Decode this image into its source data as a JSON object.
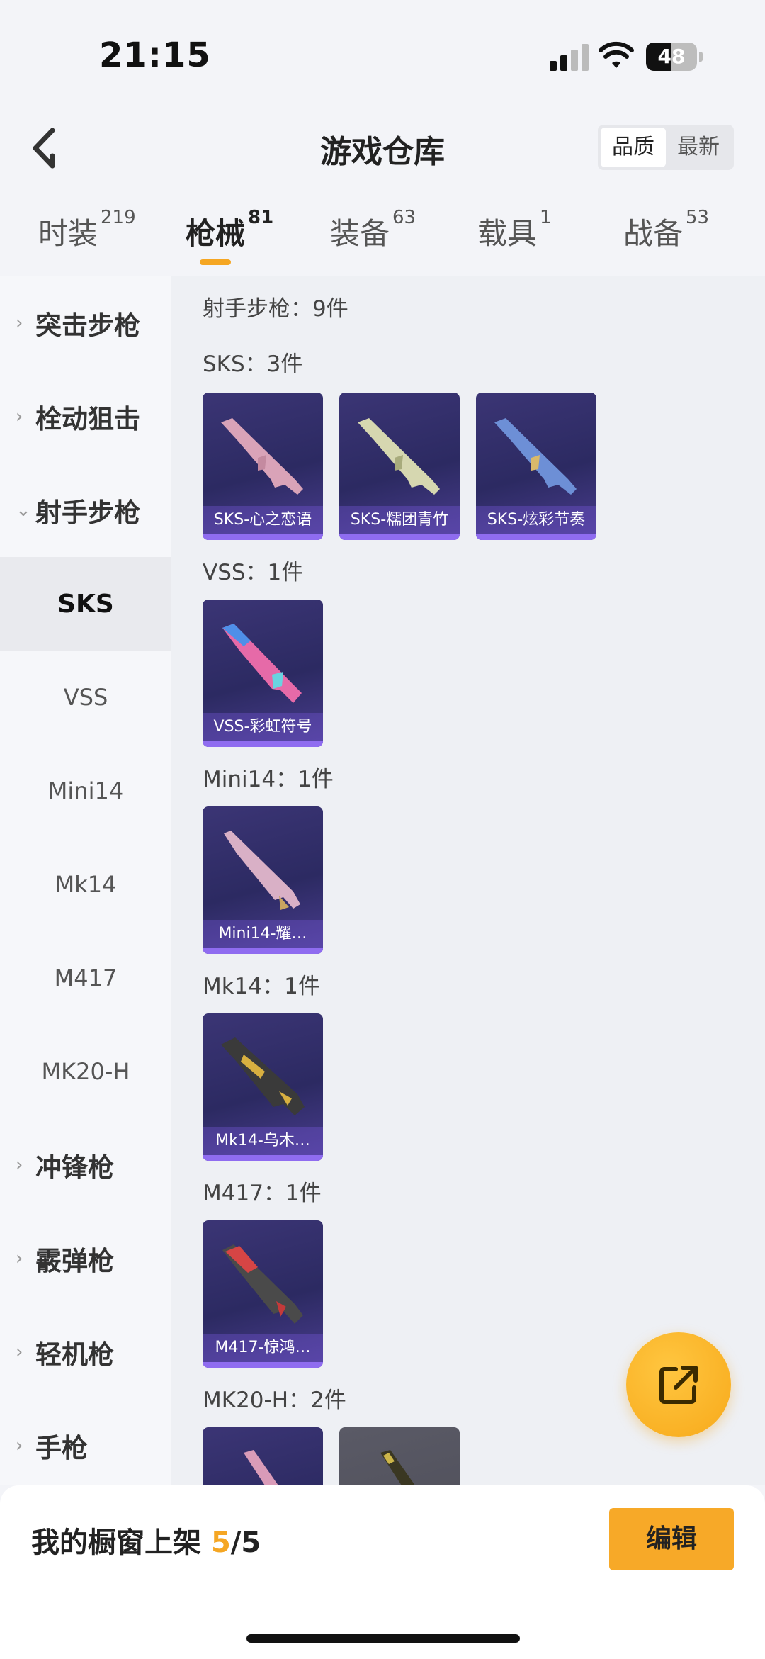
{
  "status": {
    "time": "21:15",
    "battery": "48",
    "battery_level": 0.48
  },
  "header": {
    "title": "游戏仓库",
    "sort_options": [
      "品质",
      "最新"
    ],
    "sort_selected": "品质"
  },
  "tabs": [
    {
      "label": "时装",
      "count": "219"
    },
    {
      "label": "枪械",
      "count": "81"
    },
    {
      "label": "装备",
      "count": "63"
    },
    {
      "label": "载具",
      "count": "1"
    },
    {
      "label": "战备",
      "count": "53"
    }
  ],
  "sidebar": {
    "items": [
      {
        "label": "突击步枪",
        "kind": "category",
        "chev": "›"
      },
      {
        "label": "栓动狙击",
        "kind": "category",
        "chev": "›"
      },
      {
        "label": "射手步枪",
        "kind": "category",
        "chev": "⌄"
      },
      {
        "label": "SKS",
        "kind": "sub"
      },
      {
        "label": "VSS",
        "kind": "sub"
      },
      {
        "label": "Mini14",
        "kind": "sub"
      },
      {
        "label": "Mk14",
        "kind": "sub"
      },
      {
        "label": "M417",
        "kind": "sub"
      },
      {
        "label": "MK20-H",
        "kind": "sub"
      },
      {
        "label": "冲锋枪",
        "kind": "category",
        "chev": "›"
      },
      {
        "label": "霰弹枪",
        "kind": "category",
        "chev": "›"
      },
      {
        "label": "轻机枪",
        "kind": "category",
        "chev": "›"
      },
      {
        "label": "手枪",
        "kind": "category",
        "chev": "›"
      }
    ]
  },
  "content": {
    "group_heading": "射手步枪：9件",
    "sections": [
      {
        "heading": "SKS：3件",
        "items": [
          "SKS-心之恋语",
          "SKS-糯团青竹",
          "SKS-炫彩节奏"
        ]
      },
      {
        "heading": "VSS：1件",
        "items": [
          "VSS-彩虹符号"
        ]
      },
      {
        "heading": "Mini14：1件",
        "items": [
          "Mini14-耀…"
        ]
      },
      {
        "heading": "Mk14：1件",
        "items": [
          "Mk14-乌木…"
        ]
      },
      {
        "heading": "M417：1件",
        "items": [
          "M417-惊鸿…"
        ]
      },
      {
        "heading": "MK20-H：2件",
        "items": [
          "",
          ""
        ]
      }
    ]
  },
  "bottom": {
    "showcase_label": "我的橱窗上架 ",
    "showcase_current": "5",
    "showcase_sep": "/",
    "showcase_total": "5",
    "edit_label": "编辑"
  },
  "colors": {
    "accent": "#f5a623",
    "card_bg": "#2c2a62",
    "card_strip": "#8f6cf0"
  },
  "icons": [
    "back-arrow-icon",
    "signal-icon",
    "wifi-icon",
    "battery-icon",
    "chevron-right-icon",
    "chevron-down-icon",
    "share-export-icon"
  ]
}
